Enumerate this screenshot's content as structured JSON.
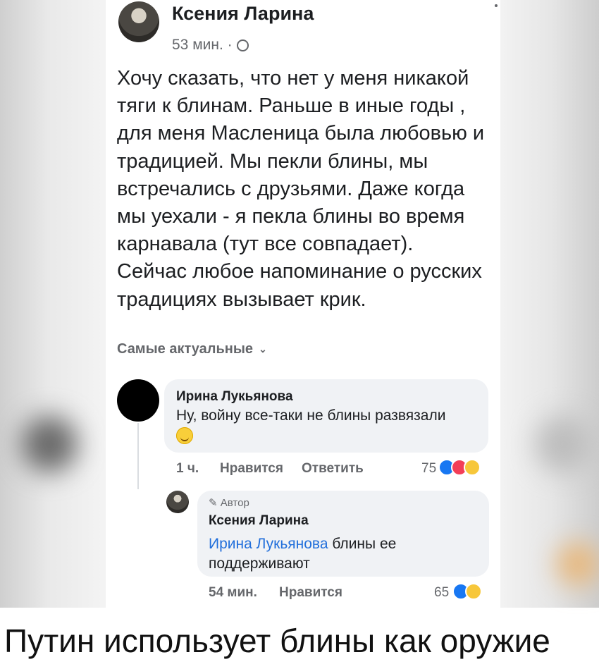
{
  "post": {
    "author": "Ксения Ларина",
    "time": "53 мин. ·",
    "text": "Хочу сказать, что нет у меня никакой\nтяги к блинам. Раньше в иные годы ,\nдля меня Масленица была любовью и\nтрадицией.  Мы пекли блины, мы\nвстречались с друзьями. Даже когда\nмы уехали - я пекла блины во время\nкарнавала (тут все совпадает).\nСейчас любое напоминание о русских\nтрадициях вызывает крик.",
    "sort_label": "Самые актуальные"
  },
  "comment1": {
    "author": "Ирина Лукьянова",
    "text": "Ну, войну все-таки не блины развязали",
    "time": "1 ч.",
    "like": "Нравится",
    "reply": "Ответить",
    "reactions": "75"
  },
  "reply1": {
    "badge": "Автор",
    "author": "Ксения Ларина",
    "mention": "Ирина Лукьянова",
    "text": " блины ее поддерживают",
    "time": "54 мин.",
    "like": "Нравится",
    "reactions": "65"
  },
  "caption": "Путин использует блины как оружие",
  "colors": {
    "link": "#216fdb",
    "bubble": "#f0f2f5",
    "like": "#1877f2"
  }
}
